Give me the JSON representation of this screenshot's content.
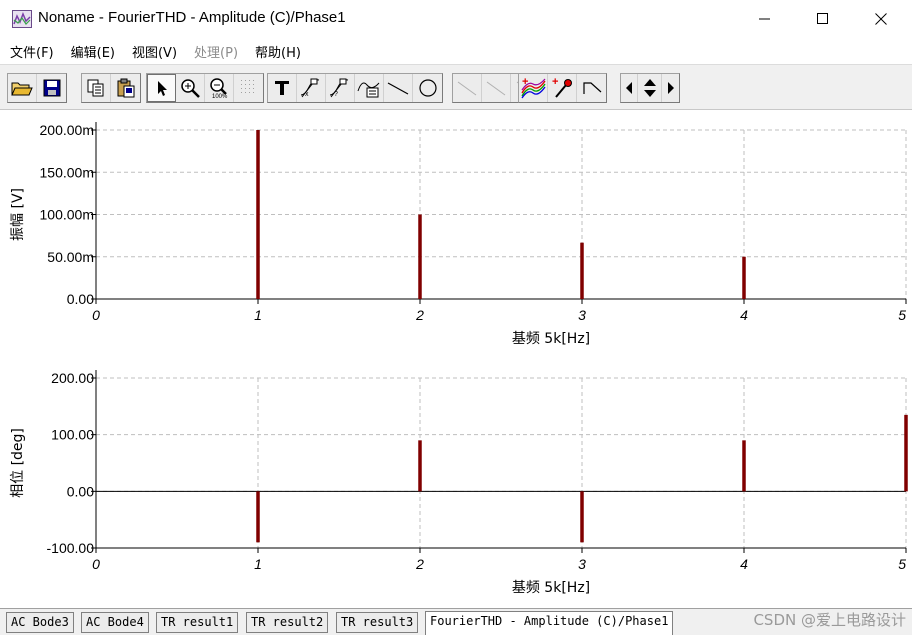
{
  "window": {
    "title": "Noname - FourierTHD - Amplitude (C)/Phase1",
    "controls": [
      "minimize",
      "maximize",
      "close"
    ]
  },
  "menu": {
    "items": [
      {
        "label": "文件(F)",
        "enabled": true
      },
      {
        "label": "编辑(E)",
        "enabled": true
      },
      {
        "label": "视图(V)",
        "enabled": true
      },
      {
        "label": "处理(P)",
        "enabled": false
      },
      {
        "label": "帮助(H)",
        "enabled": true
      }
    ]
  },
  "toolbar": {
    "icons": [
      "open-folder-icon",
      "save-icon",
      "copy-icon",
      "paste-icon",
      "pointer-icon",
      "zoom-in-icon",
      "zoom-100-icon",
      "grid-icon",
      "text-icon",
      "cursor-marker-icon",
      "cursor-marker2-icon",
      "curve-label-icon",
      "line-icon",
      "circle-icon",
      "diagonal-line-icon",
      "diagonal-line2-icon",
      "diagonal-line3-icon",
      "add-trace-icon",
      "add-probe-icon",
      "step-icon",
      "scroll-left-icon",
      "scroll-up-down-icon",
      "scroll-right-icon"
    ]
  },
  "chart_data": [
    {
      "type": "bar",
      "title": "",
      "xlabel": "基频 5k[Hz]",
      "ylabel": "振幅 [V]",
      "x": [
        1,
        2,
        3,
        4
      ],
      "values": [
        200.0,
        100.0,
        66.67,
        50.0
      ],
      "xlim": [
        0,
        5
      ],
      "ylim": [
        0,
        200
      ],
      "xticks": [
        "0",
        "1",
        "2",
        "3",
        "4",
        "5"
      ],
      "yticks": [
        "0.00",
        "50.00m",
        "100.00m",
        "150.00m",
        "200.00m"
      ],
      "grid": true,
      "color": "#800000"
    },
    {
      "type": "bar",
      "title": "",
      "xlabel": "基频 5k[Hz]",
      "ylabel": "相位 [deg]",
      "x": [
        1,
        2,
        3,
        4,
        5
      ],
      "values": [
        -90,
        90,
        -90,
        90,
        135
      ],
      "xlim": [
        0,
        5
      ],
      "ylim": [
        -100,
        200
      ],
      "xticks": [
        "0",
        "1",
        "2",
        "3",
        "4",
        "5"
      ],
      "yticks": [
        "-100.00",
        "0.00",
        "100.00",
        "200.00"
      ],
      "grid": true,
      "color": "#800000"
    }
  ],
  "tabs": [
    {
      "label": "AC Bode3",
      "active": false
    },
    {
      "label": "AC Bode4",
      "active": false
    },
    {
      "label": "TR result1",
      "active": false
    },
    {
      "label": "TR result2",
      "active": false
    },
    {
      "label": "TR result3",
      "active": false
    },
    {
      "label": "FourierTHD - Amplitude (C)/Phase1",
      "active": true
    }
  ],
  "watermark": "CSDN @爱上电路设计",
  "colors": {
    "trace": "#800000",
    "grid": "#bfbfbf",
    "toolbar_bg": "#f0f0f0"
  }
}
